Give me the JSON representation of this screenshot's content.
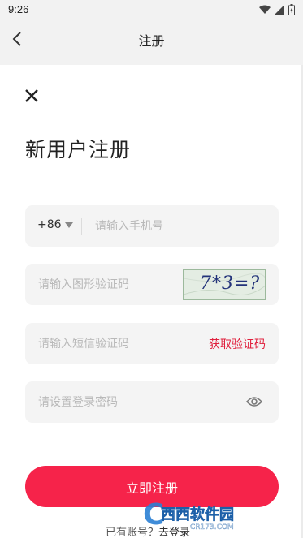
{
  "status_bar": {
    "time": "9:26"
  },
  "nav": {
    "title": "注册"
  },
  "page": {
    "title": "新用户注册"
  },
  "phone": {
    "country_code": "+86",
    "placeholder": "请输入手机号"
  },
  "captcha": {
    "placeholder": "请输入图形验证码",
    "image_text": "7*3=?"
  },
  "sms": {
    "placeholder": "请输入短信验证码",
    "get_code_label": "获取验证码"
  },
  "password": {
    "placeholder": "请设置登录密码"
  },
  "submit": {
    "label": "立即注册"
  },
  "login": {
    "prompt": "已有账号？",
    "link": "去登录"
  },
  "watermark": {
    "text": "西西软件园",
    "sub": "CR173.COM"
  },
  "colors": {
    "accent": "#f6234a",
    "link_red": "#e0203d",
    "field_bg": "#f4f4f4",
    "bar_bg": "#f2f2f2"
  }
}
